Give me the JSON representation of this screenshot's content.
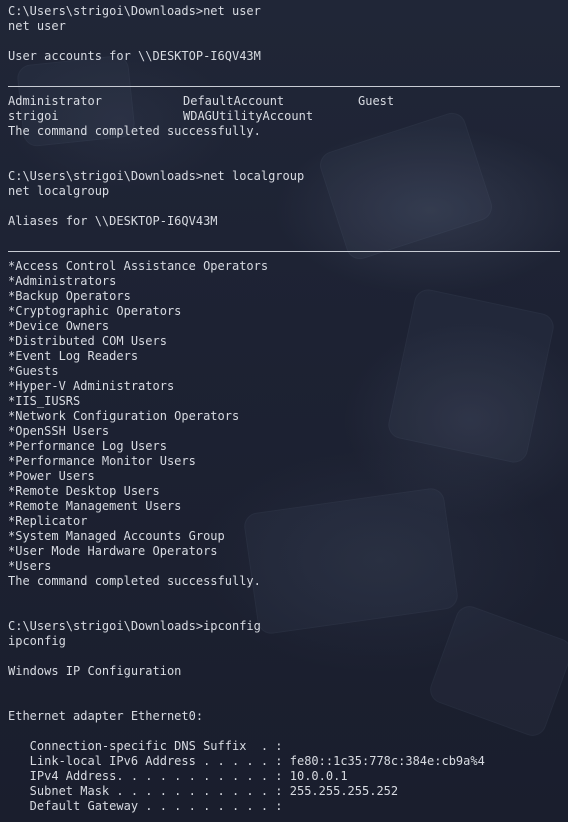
{
  "terminal": {
    "net_user_prompt": "C:\\Users\\strigoi\\Downloads>net user",
    "net_user_echo": "net user",
    "user_accounts_heading": "User accounts for \\\\DESKTOP-I6QV43M",
    "accounts": [
      [
        "Administrator",
        "DefaultAccount",
        "Guest"
      ],
      [
        "strigoi",
        "WDAGUtilityAccount",
        ""
      ]
    ],
    "completed_1": "The command completed successfully.",
    "net_localgroup_prompt": "C:\\Users\\strigoi\\Downloads>net localgroup",
    "net_localgroup_echo": "net localgroup",
    "aliases_heading": "Aliases for \\\\DESKTOP-I6QV43M",
    "groups": [
      "*Access Control Assistance Operators",
      "*Administrators",
      "*Backup Operators",
      "*Cryptographic Operators",
      "*Device Owners",
      "*Distributed COM Users",
      "*Event Log Readers",
      "*Guests",
      "*Hyper-V Administrators",
      "*IIS_IUSRS",
      "*Network Configuration Operators",
      "*OpenSSH Users",
      "*Performance Log Users",
      "*Performance Monitor Users",
      "*Power Users",
      "*Remote Desktop Users",
      "*Remote Management Users",
      "*Replicator",
      "*System Managed Accounts Group",
      "*User Mode Hardware Operators",
      "*Users"
    ],
    "completed_2": "The command completed successfully.",
    "ipconfig_prompt": "C:\\Users\\strigoi\\Downloads>ipconfig",
    "ipconfig_echo": "ipconfig",
    "ip_config_title": "Windows IP Configuration",
    "adapter_heading": "Ethernet adapter Ethernet0:",
    "adapter_details": [
      "   Connection-specific DNS Suffix  . :",
      "   Link-local IPv6 Address . . . . . : fe80::1c35:778c:384e:cb9a%4",
      "   IPv4 Address. . . . . . . . . . . : 10.0.0.1",
      "   Subnet Mask . . . . . . . . . . . : 255.255.255.252",
      "   Default Gateway . . . . . . . . . :"
    ]
  }
}
